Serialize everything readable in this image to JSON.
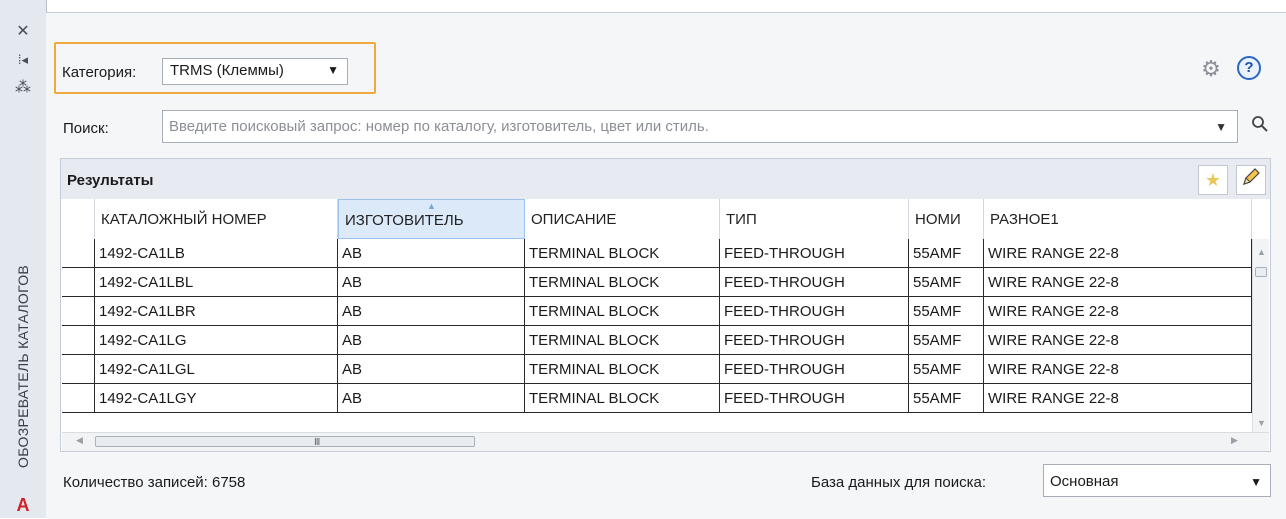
{
  "sidebar": {
    "close_glyph": "✕",
    "pin_glyph": "⁞◂",
    "settings_glyph": "⁂",
    "vertical_title": "ОБОЗРЕВАТЕЛЬ КАТАЛОГОВ",
    "logo_letter": "A"
  },
  "category": {
    "label": "Категория:",
    "value": "TRMS (Клеммы)",
    "arrow": "▼"
  },
  "icons": {
    "gear": "⚙",
    "help": "?",
    "search": "🔍",
    "star": "★",
    "pencil": "✎"
  },
  "search": {
    "label": "Поиск:",
    "placeholder": "Введите поисковый запрос: номер по каталогу, изготовитель, цвет или стиль.",
    "arrow": "▼"
  },
  "results": {
    "title": "Результаты",
    "columns": [
      "КАТАЛОЖНЫЙ НОМЕР",
      "ИЗГОТОВИТЕЛЬ",
      "ОПИСАНИЕ",
      "ТИП",
      "НОМИ",
      "РАЗНОЕ1"
    ],
    "sort_indicator": "▲",
    "rows": [
      [
        "1492-CA1LB",
        "AB",
        "TERMINAL BLOCK",
        "FEED-THROUGH",
        "55AMF",
        "WIRE RANGE 22-8"
      ],
      [
        "1492-CA1LBL",
        "AB",
        "TERMINAL BLOCK",
        "FEED-THROUGH",
        "55AMF",
        "WIRE RANGE 22-8"
      ],
      [
        "1492-CA1LBR",
        "AB",
        "TERMINAL BLOCK",
        "FEED-THROUGH",
        "55AMF",
        "WIRE RANGE 22-8"
      ],
      [
        "1492-CA1LG",
        "AB",
        "TERMINAL BLOCK",
        "FEED-THROUGH",
        "55AMF",
        "WIRE RANGE 22-8"
      ],
      [
        "1492-CA1LGL",
        "AB",
        "TERMINAL BLOCK",
        "FEED-THROUGH",
        "55AMF",
        "WIRE RANGE 22-8"
      ],
      [
        "1492-CA1LGY",
        "AB",
        "TERMINAL BLOCK",
        "FEED-THROUGH",
        "55AMF",
        "WIRE RANGE 22-8"
      ]
    ],
    "scroll": {
      "up": "▲",
      "down": "▼",
      "left": "◀",
      "right": "▶",
      "grip": "III"
    }
  },
  "footer": {
    "count_text": "Количество записей: 6758",
    "db_label": "База данных для поиска:",
    "db_value": "Основная",
    "db_arrow": "▼"
  },
  "colors": {
    "highlight": "#f0a93c",
    "accent": "#2b66c4",
    "logo": "#d0202a"
  }
}
